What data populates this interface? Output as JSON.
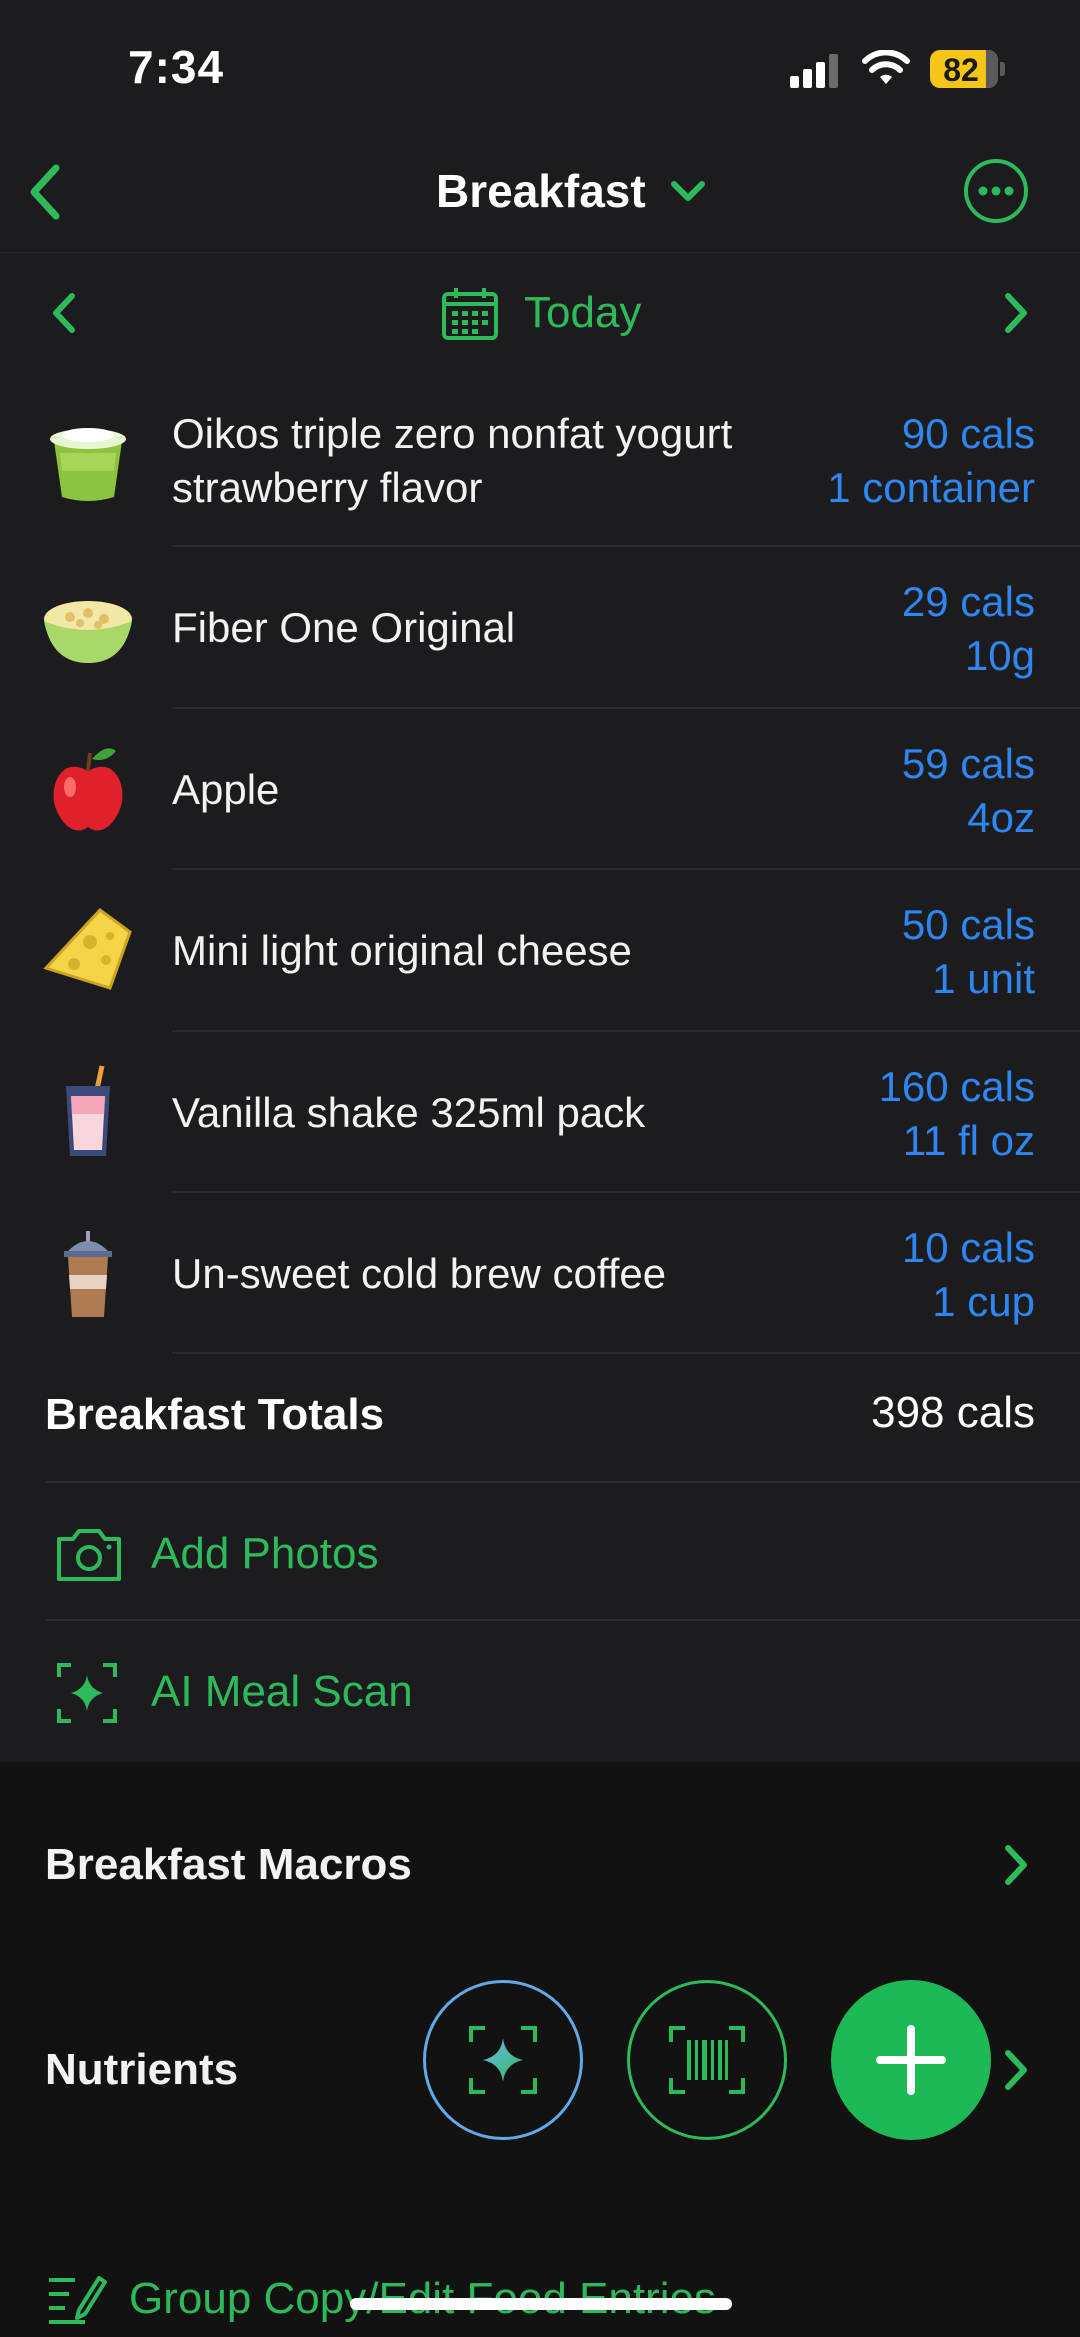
{
  "status": {
    "time": "7:34",
    "battery": "82"
  },
  "nav": {
    "title": "Breakfast",
    "back_icon": "chevron-left-icon",
    "more_icon": "ellipsis-circle-icon"
  },
  "date": {
    "label": "Today"
  },
  "foods": [
    {
      "name_line1": "Oikos triple zero nonfat yogurt",
      "name_line2": "strawberry flavor",
      "cals": "90 cals",
      "serving": "1 container",
      "icon": "yogurt-cup-icon"
    },
    {
      "name_line1": "Fiber One Original",
      "name_line2": "",
      "cals": "29 cals",
      "serving": "10g",
      "icon": "cereal-bowl-icon"
    },
    {
      "name_line1": "Apple",
      "name_line2": "",
      "cals": "59 cals",
      "serving": "4oz",
      "icon": "apple-icon"
    },
    {
      "name_line1": "Mini light original cheese",
      "name_line2": "",
      "cals": "50 cals",
      "serving": "1 unit",
      "icon": "cheese-icon"
    },
    {
      "name_line1": "Vanilla shake 325ml pack",
      "name_line2": "",
      "cals": "160 cals",
      "serving": "11 fl oz",
      "icon": "shake-glass-icon"
    },
    {
      "name_line1": "Un-sweet cold brew coffee",
      "name_line2": "",
      "cals": "10 cals",
      "serving": "1 cup",
      "icon": "iced-coffee-icon"
    }
  ],
  "totals": {
    "label": "Breakfast Totals",
    "value": "398 cals"
  },
  "actions": {
    "add_photos": "Add Photos",
    "ai_scan": "AI Meal Scan"
  },
  "sections": {
    "macros": "Breakfast Macros",
    "nutrients": "Nutrients",
    "group_copy": "Group Copy/Edit Food Entries"
  },
  "colors": {
    "accent": "#2DBA5A",
    "link": "#2E86F0",
    "background": "#1c1c1e",
    "battery": "#F5C518"
  }
}
